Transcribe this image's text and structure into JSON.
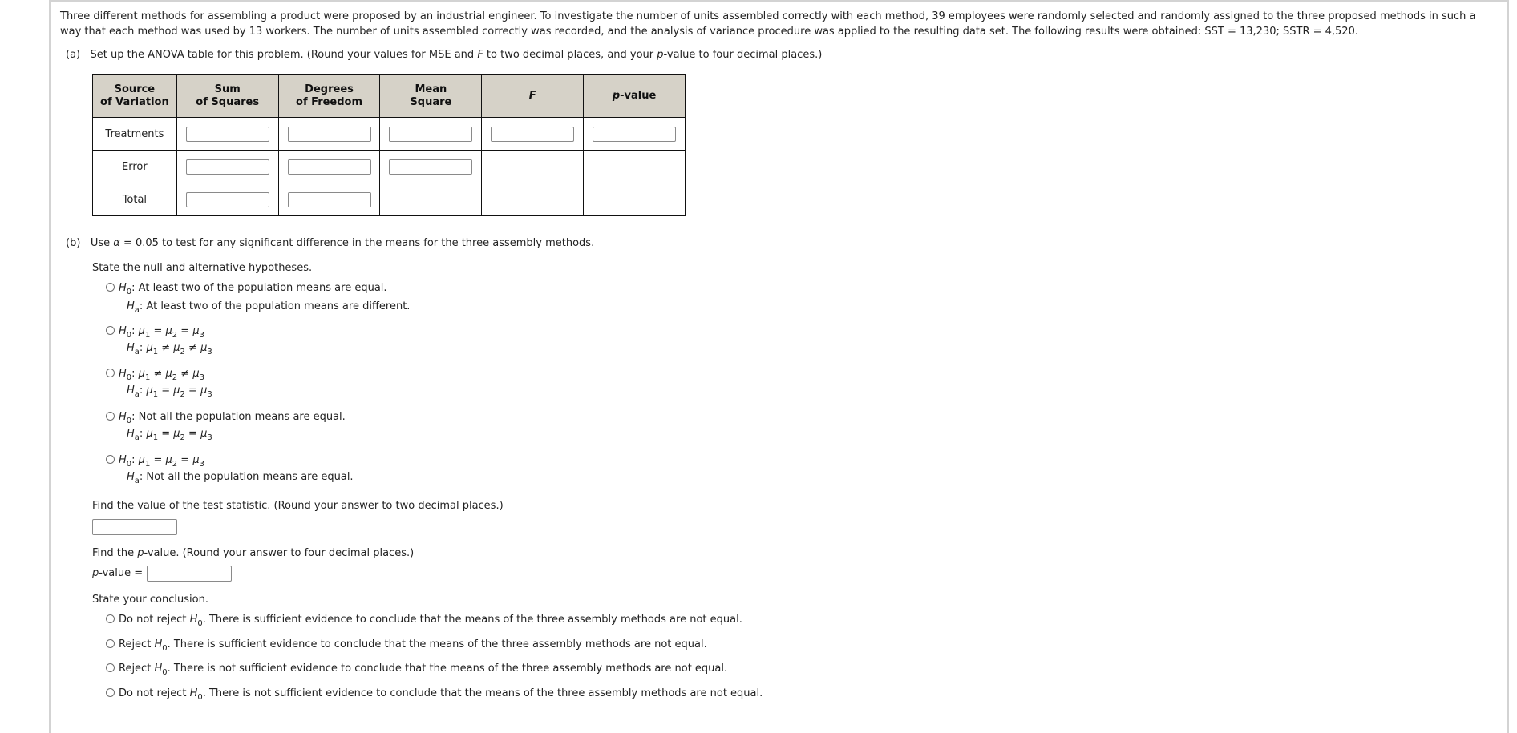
{
  "problem": {
    "intro": "Three different methods for assembling a product were proposed by an industrial engineer. To investigate the number of units assembled correctly with each method, 39 employees were randomly selected and randomly assigned to the three proposed methods in such a way that each method was used by 13 workers. The number of units assembled correctly was recorded, and the analysis of variance procedure was applied to the resulting data set. The following results were obtained: SST = 13,230; SSTR = 4,520."
  },
  "part_a": {
    "label": "(a)",
    "instruction_1": "Set up the ANOVA table for this problem. (Round your values for MSE and ",
    "instruction_F": "F",
    "instruction_2": " to two decimal places, and your ",
    "instruction_p": "p",
    "instruction_3": "-value to four decimal places.)",
    "table": {
      "headers": {
        "source_1": "Source",
        "source_2": "of Variation",
        "ss_1": "Sum",
        "ss_2": "of Squares",
        "df_1": "Degrees",
        "df_2": "of Freedom",
        "ms_1": "Mean",
        "ms_2": "Square",
        "f": "F",
        "p_italic": "p",
        "p_rest": "-value"
      },
      "rows": [
        {
          "source": "Treatments",
          "ss": "",
          "df": "",
          "ms": "",
          "f": "",
          "p": ""
        },
        {
          "source": "Error",
          "ss": "",
          "df": "",
          "ms": ""
        },
        {
          "source": "Total",
          "ss": "",
          "df": ""
        }
      ]
    }
  },
  "part_b": {
    "label": "(b)",
    "instruction_1": "Use ",
    "alpha_symbol": "α",
    "instruction_2": " = 0.05 to test for any significant difference in the means for the three assembly methods.",
    "hypotheses_prompt": "State the null and alternative hypotheses.",
    "hypotheses": [
      {
        "h0": ": At least two of the population means are equal.",
        "ha": ": At least two of the population means are different."
      },
      {
        "h0": "μ1 = μ2 = μ3",
        "ha": "μ1 ≠ μ2 ≠ μ3"
      },
      {
        "h0": "μ1 ≠ μ2 ≠ μ3",
        "ha": "μ1 = μ2 = μ3"
      },
      {
        "h0": ": Not all the population means are equal.",
        "ha": "μ1 = μ2 = μ3"
      },
      {
        "h0": "μ1 = μ2 = μ3",
        "ha": ": Not all the population means are equal."
      }
    ],
    "test_stat_prompt": "Find the value of the test statistic. (Round your answer to two decimal places.)",
    "test_stat_value": "",
    "pvalue_prompt_1": "Find the ",
    "pvalue_prompt_p": "p",
    "pvalue_prompt_2": "-value. (Round your answer to four decimal places.)",
    "pvalue_label_p": "p",
    "pvalue_label_rest": "-value = ",
    "pvalue_value": "",
    "conclusion_prompt": "State your conclusion.",
    "conclusions": [
      {
        "lead": "Do not reject ",
        "rest": ". There is sufficient evidence to conclude that the means of the three assembly methods are not equal."
      },
      {
        "lead": "Reject ",
        "rest": ". There is sufficient evidence to conclude that the means of the three assembly methods are not equal."
      },
      {
        "lead": "Reject ",
        "rest": ". There is not sufficient evidence to conclude that the means of the three assembly methods are not equal."
      },
      {
        "lead": "Do not reject ",
        "rest": ". There is not sufficient evidence to conclude that the means of the three assembly methods are not equal."
      }
    ],
    "symbols": {
      "H": "H",
      "sub0": "0",
      "suba": "a",
      "mu": "μ",
      "sub1": "1",
      "sub2": "2",
      "sub3": "3",
      "eq": " = ",
      "neq": " ≠ ",
      "colon": ": "
    }
  }
}
